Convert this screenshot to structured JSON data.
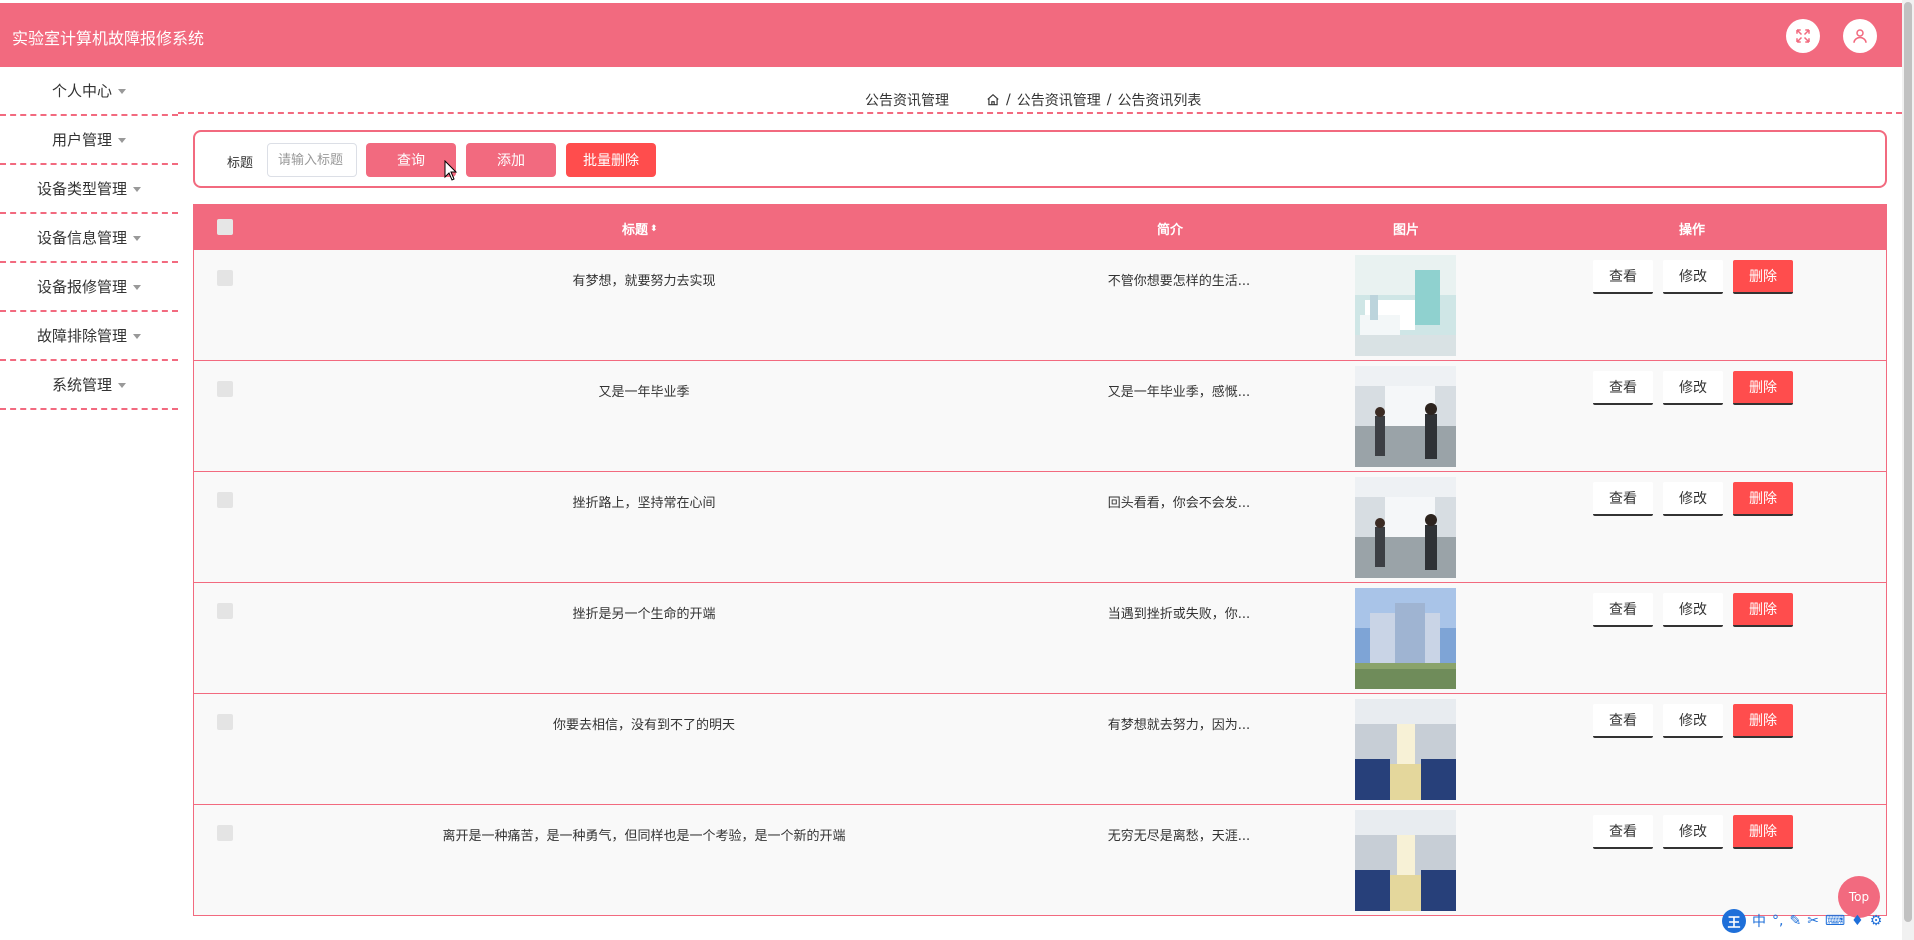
{
  "header": {
    "app_title": "实验室计算机故障报修系统"
  },
  "sidebar": {
    "items": [
      {
        "label": "个人中心"
      },
      {
        "label": "用户管理"
      },
      {
        "label": "设备类型管理"
      },
      {
        "label": "设备信息管理"
      },
      {
        "label": "设备报修管理"
      },
      {
        "label": "故障排除管理"
      },
      {
        "label": "系统管理"
      }
    ]
  },
  "breadcrumb": {
    "page_name": "公告资讯管理",
    "level1": "公告资讯管理",
    "level2": "公告资讯列表",
    "separator": "/"
  },
  "search": {
    "label": "标题",
    "placeholder": "请输入标题",
    "query_label": "查询",
    "add_label": "添加",
    "batch_delete_label": "批量删除"
  },
  "table": {
    "columns": {
      "title": "标题",
      "brief": "简介",
      "image": "图片",
      "actions": "操作"
    },
    "actions": {
      "view": "查看",
      "edit": "修改",
      "delete": "删除"
    },
    "rows": [
      {
        "title": "有梦想，就要努力去实现",
        "brief": "不管你想要怎样的生活...",
        "image": "hospital-ward"
      },
      {
        "title": "又是一年毕业季",
        "brief": "又是一年毕业季，感慨...",
        "image": "lobby-people"
      },
      {
        "title": "挫折路上，坚持常在心间",
        "brief": "回头看看，你会不会发...",
        "image": "lobby-people"
      },
      {
        "title": "挫折是另一个生命的开端",
        "brief": "当遇到挫折或失败，你...",
        "image": "building-exterior"
      },
      {
        "title": "你要去相信，没有到不了的明天",
        "brief": "有梦想就去努力，因为...",
        "image": "waiting-hall"
      },
      {
        "title": "离开是一种痛苦，是一种勇气，但同样也是一个考验，是一个新的开端",
        "brief": "无穷无尽是离愁，天涯...",
        "image": "waiting-hall"
      }
    ]
  },
  "back_to_top": "Top",
  "ime": {
    "logo": "王",
    "mode": "中"
  }
}
